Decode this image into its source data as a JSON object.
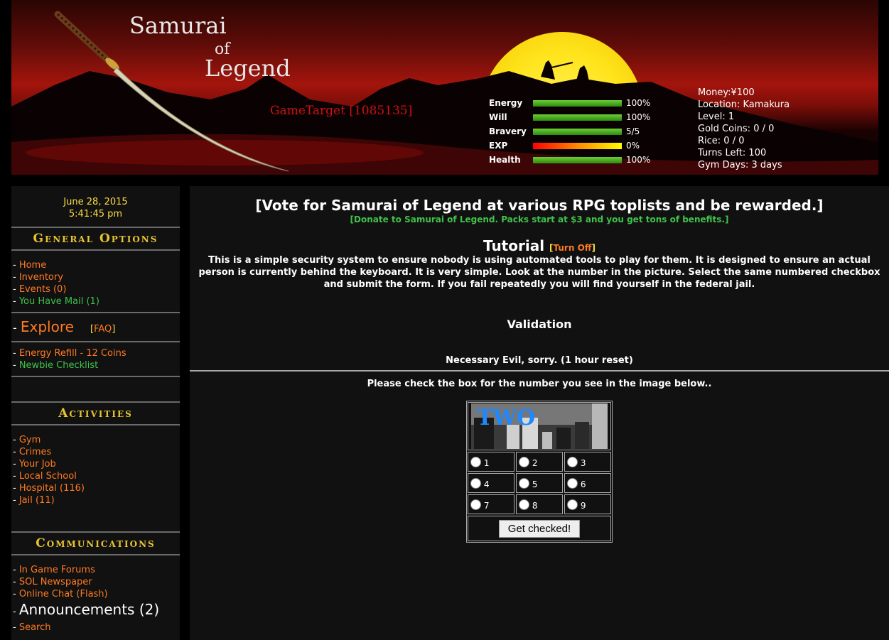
{
  "header": {
    "title_line1": "Samurai",
    "title_line2": "of",
    "title_line3": "Legend",
    "gametarget": "GameTarget [1085135]",
    "stats": [
      {
        "label": "Energy",
        "value": "100%",
        "fill": 1.0
      },
      {
        "label": "Will",
        "value": "100%",
        "fill": 1.0
      },
      {
        "label": "Bravery",
        "value": "5/5",
        "fill": 1.0
      },
      {
        "label": "EXP",
        "value": "0%",
        "fill": 1.0
      },
      {
        "label": "Health",
        "value": "100%",
        "fill": 1.0
      }
    ],
    "info": {
      "money": "Money:¥100",
      "location": "Location: Kamakura",
      "level": "Level: 1",
      "gold": "Gold Coins: 0 / 0",
      "rice": "Rice: 0 / 0",
      "turns": "Turns Left: 100",
      "gym": "Gym Days: 3 days"
    }
  },
  "sidebar": {
    "date": "June 28, 2015",
    "time": "5:41:45 pm",
    "general": {
      "heading": "General Options",
      "items": [
        "Home",
        "Inventory",
        "Events (0)",
        "You Have Mail (1)"
      ]
    },
    "explore": {
      "label": "Explore",
      "faq": "FAQ"
    },
    "extras": [
      "Energy Refill -  12 Coins",
      "Newbie Checklist"
    ],
    "activities": {
      "heading": "Activities",
      "items": [
        "Gym",
        "Crimes",
        "Your Job",
        "Local School",
        "Hospital (116)",
        "Jail (11)"
      ]
    },
    "communications": {
      "heading": "Communications",
      "items": [
        "In Game Forums",
        "SOL Newspaper",
        "Online Chat (Flash)",
        "Announcements (2)",
        "Search"
      ]
    }
  },
  "main": {
    "vote": "[Vote for Samurai of Legend at various RPG toplists and be rewarded.]",
    "donate": "[Donate to Samurai of Legend. Packs start at $3 and you get tons of benefits.]",
    "tutorial": "Tutorial",
    "turn_off": "Turn Off",
    "description": "This is a simple security system to ensure nobody is using automated tools to play for them. It is designed to ensure an actual person is currently behind the keyboard. It is very simple. Look at the number in the picture. Select the same numbered checkbox and submit the form. If you fail repeatedly you will find yourself in the federal jail.",
    "validation": "Validation",
    "evil": "Necessary Evil, sorry. (1 hour reset)",
    "please": "Please check the box for the number you see in the image below..",
    "captcha_word": "TWO",
    "options": [
      "1",
      "2",
      "3",
      "4",
      "5",
      "6",
      "7",
      "8",
      "9"
    ],
    "submit": "Get checked!"
  },
  "colors": {
    "link_orange": "#ff7a22",
    "link_green": "#3fc24a",
    "heading_gold": "#e8c530",
    "date_yellow": "#ffdd44",
    "gametarget_red": "#cc1111"
  }
}
